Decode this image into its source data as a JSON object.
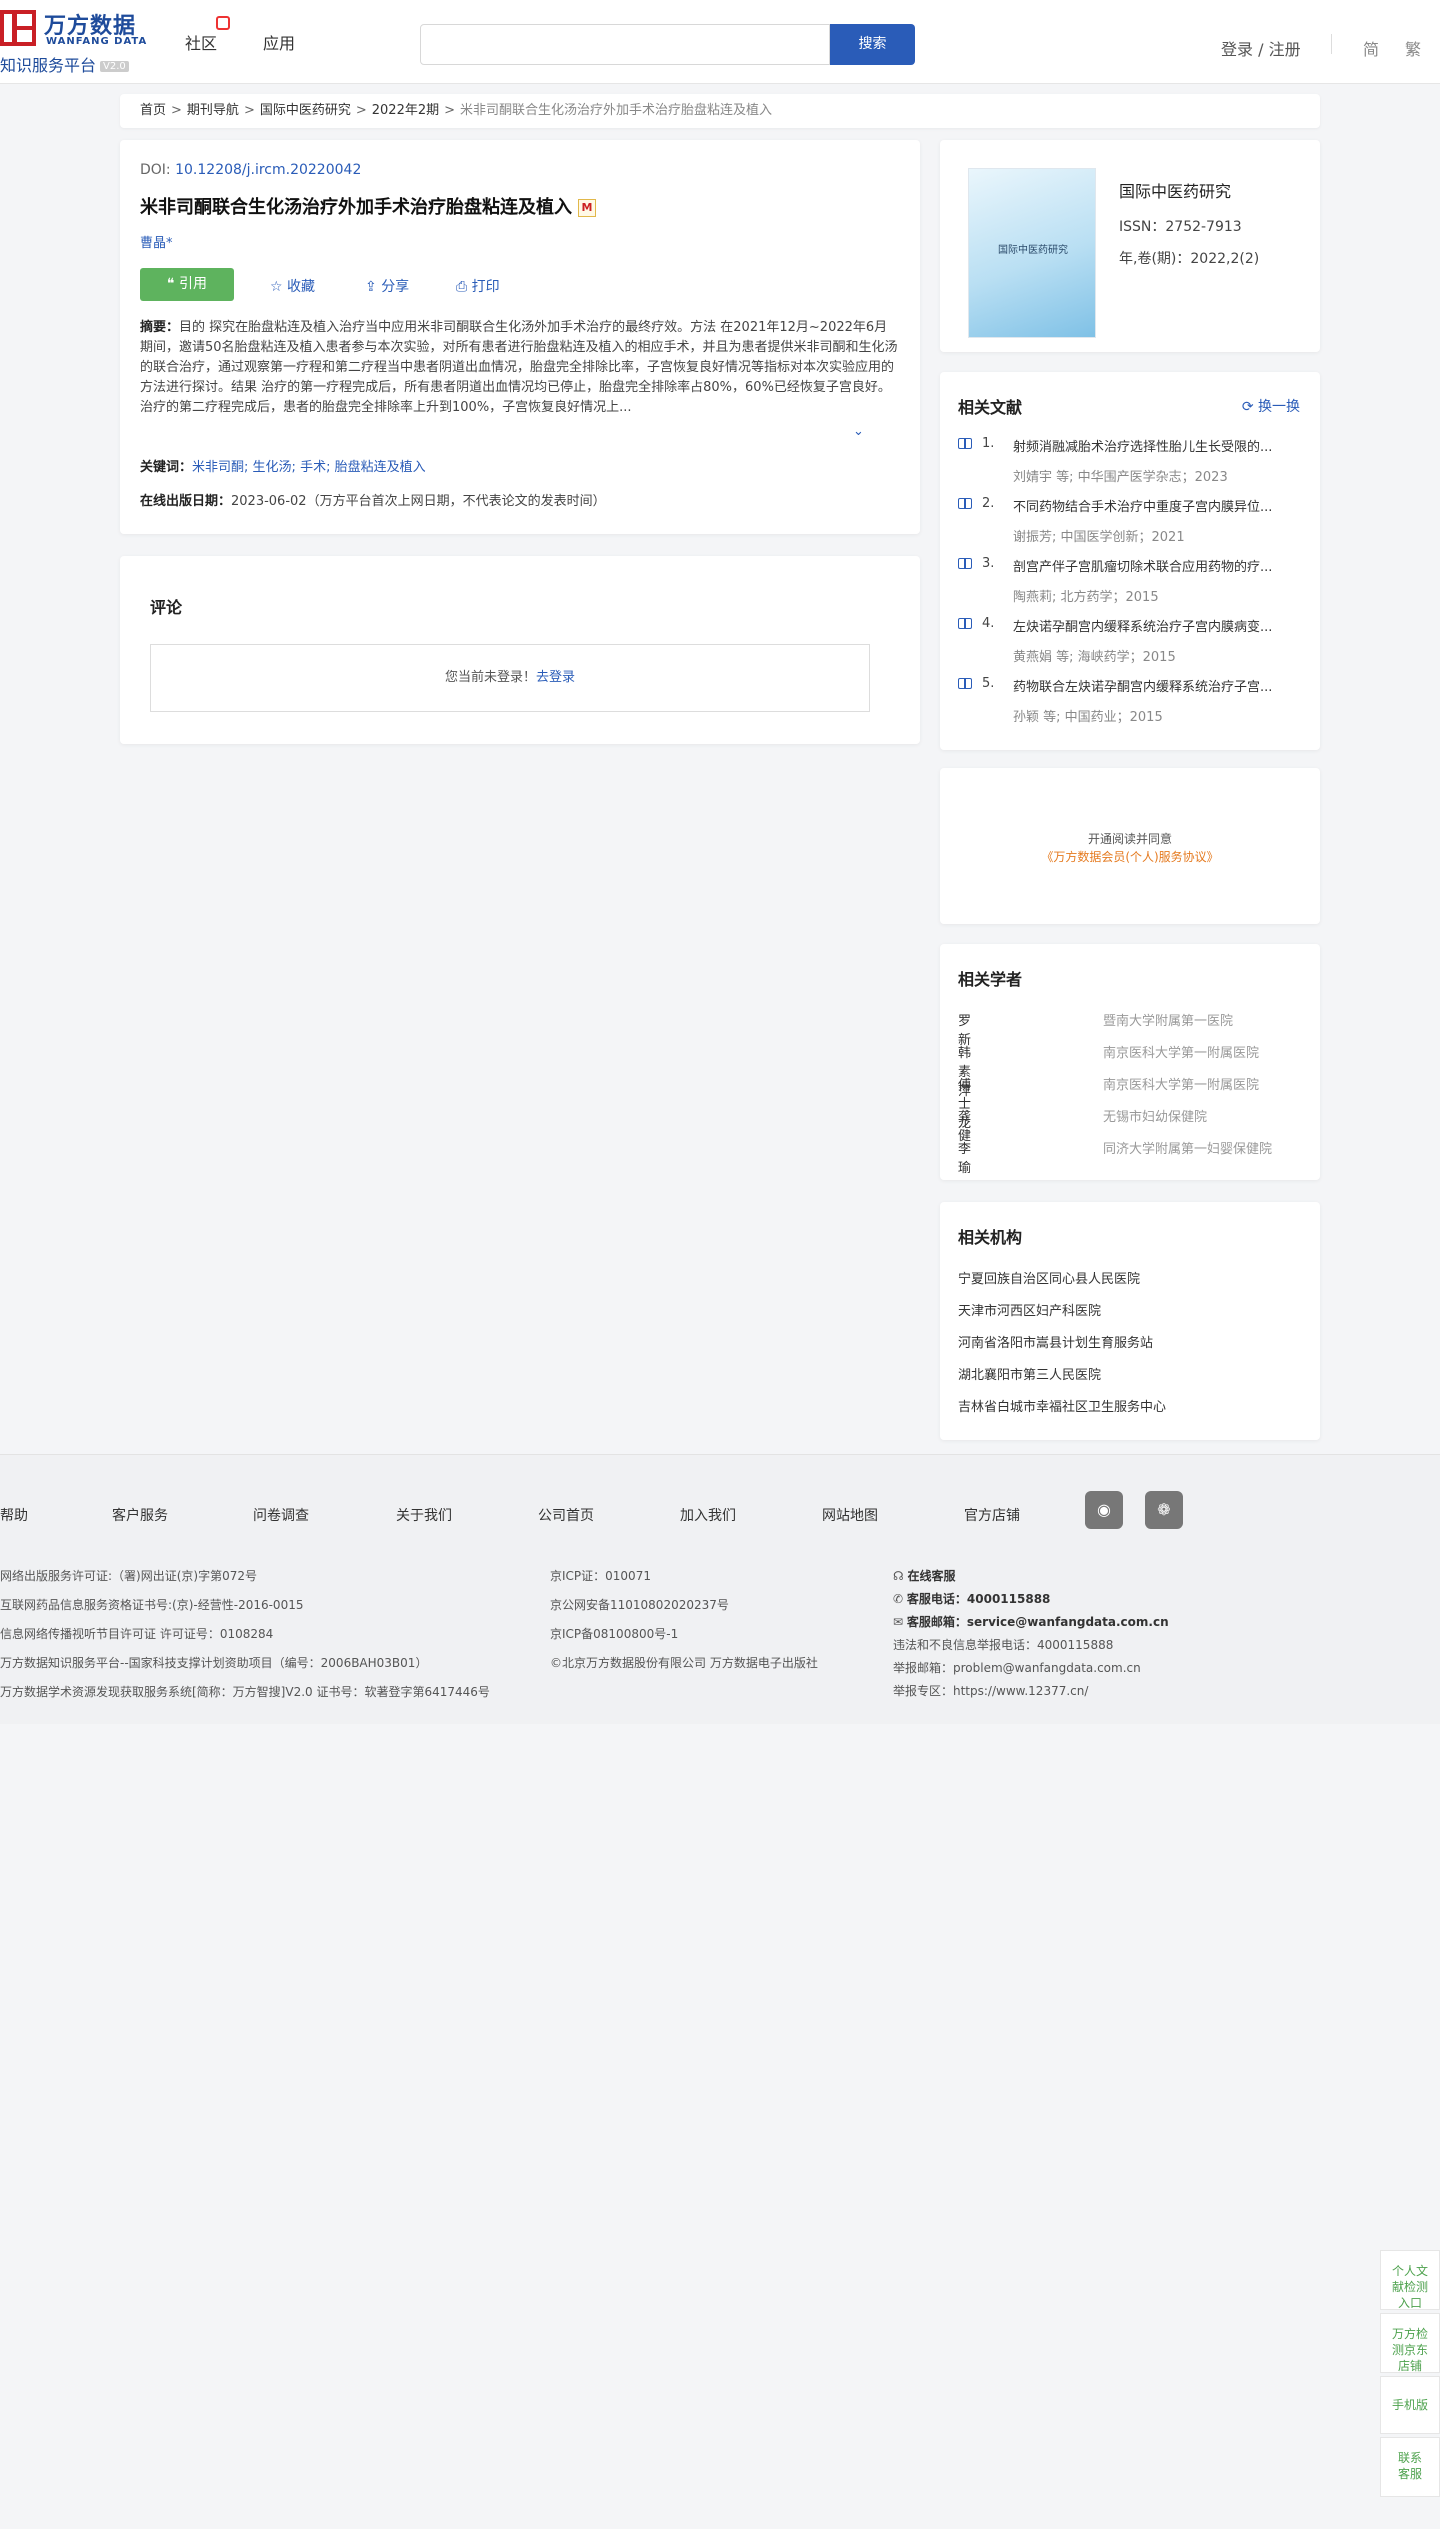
{
  "header": {
    "logo_cn": "万方数据",
    "logo_en": "WANFANG DATA",
    "logo_sub": "知识服务平台",
    "logo_version": "V2.0",
    "nav": [
      "社区",
      "应用"
    ],
    "search_placeholder": "",
    "search_button": "搜索",
    "login": "登录 / 注册",
    "lang_simplified": "简",
    "lang_traditional": "繁"
  },
  "breadcrumb": {
    "items": [
      "首页",
      "期刊导航",
      "国际中医药研究",
      "2022年2期"
    ],
    "separator": ">",
    "current": "米非司酮联合生化汤治疗外加手术治疗胎盘粘连及植入"
  },
  "article": {
    "doi_label": "DOI:",
    "doi": "10.12208/j.ircm.20220042",
    "title": "米非司酮联合生化汤治疗外加手术治疗胎盘粘连及植入",
    "m_icon": "M",
    "author": "曹晶*",
    "actions": {
      "cite": "引用",
      "favorite": "收藏",
      "share": "分享",
      "print": "打印"
    },
    "abstract_label": "摘要：",
    "abstract": "目的 探究在胎盘粘连及植入治疗当中应用米非司酮联合生化汤外加手术治疗的最终疗效。方法 在2021年12月~2022年6月期间，邀请50名胎盘粘连及植入患者参与本次实验，对所有患者进行胎盘粘连及植入的相应手术，并且为患者提供米非司酮和生化汤的联合治疗，通过观察第一疗程和第二疗程当中患者阴道出血情况，胎盘完全排除比率，子宫恢复良好情况等指标对本次实验应用的方法进行探讨。结果 治疗的第一疗程完成后，所有患者阴道出血情况均已停止，胎盘完全排除率占80%，60%已经恢复子宫良好。治疗的第二疗程完成后，患者的胎盘完全排除率上升到100%，子宫恢复良好情况上...",
    "keywords_label": "关键词：",
    "keywords": [
      "米非司酮;",
      "生化汤;",
      "手术;",
      "胎盘粘连及植入"
    ],
    "online_label": "在线出版日期：",
    "online_date": "2023-06-02",
    "online_note": "（万方平台首次上网日期，不代表论文的发表时间）"
  },
  "comment": {
    "title": "评论",
    "notice": "您当前未登录！",
    "login_link": "去登录"
  },
  "journal": {
    "cover_text": "国际中医药研究",
    "name": "国际中医药研究",
    "issn": "ISSN：2752-7913",
    "volume": "年,卷(期)：2022,2(2)"
  },
  "related_docs": {
    "title": "相关文献",
    "swap": "换一换",
    "items": [
      {
        "num": "1.",
        "title": "射频消融减胎术治疗选择性胎儿生长受限的...",
        "meta": "刘婧宇  等;  中华围产医学杂志；2023"
      },
      {
        "num": "2.",
        "title": "不同药物结合手术治疗中重度子宫内膜异位...",
        "meta": "谢振芳; 中国医学创新；2021"
      },
      {
        "num": "3.",
        "title": "剖宫产伴子宫肌瘤切除术联合应用药物的疗...",
        "meta": "陶燕莉; 北方药学；2015"
      },
      {
        "num": "4.",
        "title": "左炔诺孕酮宫内缓释系统治疗子宫内膜病变...",
        "meta": "黄燕娟  等;  海峡药学；2015"
      },
      {
        "num": "5.",
        "title": "药物联合左炔诺孕酮宫内缓释系统治疗子宫...",
        "meta": "孙颖  等;  中国药业；2015"
      }
    ]
  },
  "agreement": {
    "line1": "开通阅读并同意",
    "line2": "《万方数据会员(个人)服务协议》"
  },
  "scholars": {
    "title": "相关学者",
    "items": [
      {
        "name": "罗新",
        "org": "暨南大学附属第一医院"
      },
      {
        "name": "韩素萍",
        "org": "南京医科大学第一附属医院"
      },
      {
        "name": "傅士龙",
        "org": "南京医科大学第一附属医院"
      },
      {
        "name": "龚健",
        "org": "无锡市妇幼保健院"
      },
      {
        "name": "李瑜",
        "org": "同济大学附属第一妇婴保健院"
      }
    ]
  },
  "institutions": {
    "title": "相关机构",
    "items": [
      "宁夏回族自治区同心县人民医院",
      "天津市河西区妇产科医院",
      "河南省洛阳市嵩县计划生育服务站",
      "湖北襄阳市第三人民医院",
      "吉林省白城市幸福社区卫生服务中心"
    ]
  },
  "footer": {
    "links": [
      "帮助",
      "客户服务",
      "问卷调查",
      "关于我们",
      "公司首页",
      "加入我们",
      "网站地图",
      "官方店铺"
    ],
    "col1": [
      "网络出版服务许可证:（署)网出证(京)字第072号",
      "互联网药品信息服务资格证书号:(京)-经营性-2016-0015",
      "信息网络传播视听节目许可证 许可证号：0108284",
      "万方数据知识服务平台--国家科技支撑计划资助项目（编号：2006BAH03B01）",
      "万方数据学术资源发现获取服务系统[简称：万方智搜]V2.0 证书号：软著登字第6417446号"
    ],
    "col2": [
      "京ICP证：010071",
      "京公网安备11010802020237号",
      "京ICP备08100800号-1",
      "©北京万方数据股份有限公司 万方数据电子出版社"
    ],
    "online_service": "在线客服",
    "phone_label": "客服电话：",
    "phone": "4000115888",
    "email_label": "客服邮箱：",
    "email": "service@wanfangdata.com.cn",
    "report_phone": "违法和不良信息举报电话：4000115888",
    "report_email": "举报邮箱：problem@wanfangdata.com.cn",
    "report_site": "举报专区：https://www.12377.cn/"
  },
  "float": {
    "item1": "个人文献检测入口",
    "item2": "万方检测京东店铺",
    "item3": "手机版",
    "item4": "联系客服"
  }
}
